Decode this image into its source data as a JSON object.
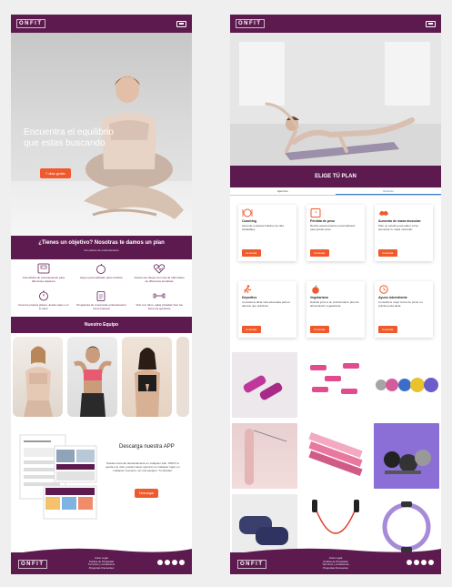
{
  "brand": {
    "logo": "ONFIT"
  },
  "home": {
    "hero": {
      "title": "Encuentra el equilibrio que estas buscando",
      "cta": "7 dias gratis"
    },
    "goal": {
      "title": "¿Tienes un objetivo? Nosotras te damos un plan",
      "subtitle": "Ver planes de entrenamiento"
    },
    "features": [
      {
        "icon": "scale-icon",
        "caption": "Consultoria de entrenamiento para diferentes objetivos"
      },
      {
        "icon": "apple-icon",
        "caption": "Apoyo personalizado para nutricion"
      },
      {
        "icon": "heart-pulse-icon",
        "caption": "Acceso de clases con mas de 100 videos de diferentes tematicas"
      },
      {
        "icon": "timer-icon",
        "caption": "Crea tus propios planes, desde casa o en tu ritmo"
      },
      {
        "icon": "clipboard-icon",
        "caption": "Programas de 4 semanas entrenamiento como fusionar"
      },
      {
        "icon": "dumbbell-icon",
        "caption": "Vivir a tu ritmo, salas privadas Vive tus fotos tus ejercicios"
      }
    ],
    "team_title": "Nuestro Equipo",
    "app": {
      "title": "Descarga nuestra APP",
      "description": "Puedes entrenar absolutamente en cualquier sitio. ONFIT te ayuda a tu vida, puedes hacer ejercicio en cualquier lugar, en cualquier momento, sin una aseguro. Tu decides.",
      "button": "Descargar"
    }
  },
  "plans_page": {
    "title": "ELIGE TÚ PLAN",
    "tabs": [
      "Ejercicio",
      "Nutrición"
    ],
    "active_tab": "Nutrición",
    "plans": [
      {
        "icon": "plate-icon",
        "name": "Coaching",
        "desc": "Aprende a adoptar hábitos de vida saludables",
        "button": "Contratar"
      },
      {
        "icon": "scale-icon",
        "name": "Pérdida de peso",
        "desc": "Recibe asesoramiento personalizado para perder peso.",
        "button": "Contratar"
      },
      {
        "icon": "muscle-icon",
        "name": "Aumento de masa muscular",
        "desc": "Pide un estudio para saber cómo aumentar tu masa muscular.",
        "button": "Contratar"
      },
      {
        "icon": "runner-icon",
        "name": "Deportivo",
        "desc": "Consulta la dieta más adecuada para el deporte que practicas.",
        "button": "Contratar"
      },
      {
        "icon": "apple-icon",
        "name": "Vegetariano",
        "desc": "Definite junto a un profesional tu plan de alimentación vegetariana.",
        "button": "Contratar"
      },
      {
        "icon": "clock-icon",
        "name": "Ayuno intermitente",
        "desc": "Consulta la mejor forma de poner en práctica esta dieta.",
        "button": "Contratar"
      }
    ],
    "products": [
      "pink-dumbbells",
      "pink-dumbbell-set",
      "kettlebells",
      "yoga-mat",
      "resistance-bands",
      "dumbbell-set",
      "ankle-weights",
      "jump-rope",
      "pilates-ring"
    ]
  },
  "footer": {
    "links": [
      "Aviso Legal",
      "Política de Privacidad",
      "Términos y condiciones",
      "Preguntas Frecuentes"
    ]
  },
  "colors": {
    "primary": "#5c1a4f",
    "accent": "#f0592b",
    "tab_active": "#3a7bd5"
  }
}
